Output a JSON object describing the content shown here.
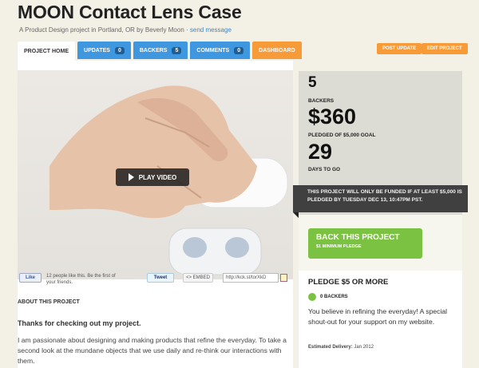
{
  "project": {
    "title": "MOON Contact Lens Case",
    "subtitle_prefix": "A Product Design project in Portland, OR by Beverly Moon · ",
    "send_message": "send message"
  },
  "tabs": [
    {
      "label": "PROJECT HOME"
    },
    {
      "label": "UPDATES",
      "count": "0"
    },
    {
      "label": "BACKERS",
      "count": "5"
    },
    {
      "label": "COMMENTS",
      "count": "0"
    },
    {
      "label": "DASHBOARD"
    }
  ],
  "actions": {
    "post_update": "POST UPDATE",
    "edit_project": "EDIT PROJECT"
  },
  "video": {
    "play_label": "PLAY VIDEO"
  },
  "social": {
    "like": "Like",
    "like_text": "12 people like this. Be the first of your friends.",
    "tweet": "Tweet",
    "embed": "<> EMBED",
    "short_url": "http://kck.st/torXkD"
  },
  "about": {
    "heading": "ABOUT THIS PROJECT",
    "intro": "Thanks for checking out my project.",
    "paragraph": "I am passionate about designing and making products that refine the everyday. To take a second look at the mundane objects that we use daily and re-think our interactions with them."
  },
  "stats": {
    "backers_value": "5",
    "backers_label": "BACKERS",
    "pledged_value": "$360",
    "pledged_label": "PLEDGED OF $5,000 GOAL",
    "days_value": "29",
    "days_label": "DAYS TO GO"
  },
  "notice": "THIS PROJECT WILL ONLY BE FUNDED IF AT LEAST $5,000 IS PLEDGED BY TUESDAY DEC 13, 10:47PM PST.",
  "back_button": {
    "label": "BACK THIS PROJECT",
    "sub": "$1 MINIMUM PLEDGE"
  },
  "reward": {
    "heading": "PLEDGE $5 OR MORE",
    "backers": "0 BACKERS",
    "description": "You believe in refining the everyday! A special shout-out for your support on my website.",
    "estimated_label": "Estimated Delivery:",
    "estimated_value": "Jan 2012"
  },
  "colors": {
    "accent_blue": "#3f97df",
    "accent_orange": "#f79a38",
    "accent_green": "#7cc242"
  }
}
